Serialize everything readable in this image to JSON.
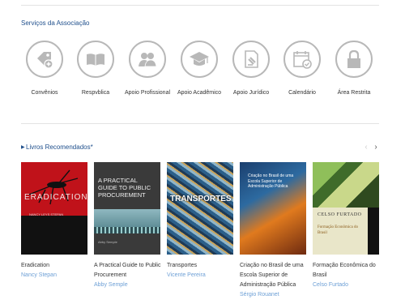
{
  "services_section": {
    "title": "Serviços da Associação",
    "items": [
      {
        "label": "Convênios",
        "icon": "tag-plus-icon"
      },
      {
        "label": "Respvblica",
        "icon": "open-book-icon"
      },
      {
        "label": "Apoio Profissional",
        "icon": "people-icon"
      },
      {
        "label": "Apoio Acadêmico",
        "icon": "graduation-cap-icon"
      },
      {
        "label": "Apoio Jurídico",
        "icon": "document-gavel-icon"
      },
      {
        "label": "Calendário",
        "icon": "calendar-check-icon"
      },
      {
        "label": "Área Restrita",
        "icon": "padlock-icon"
      }
    ]
  },
  "books_section": {
    "title": "Livros Recomendados*",
    "prev": "‹",
    "next": "›",
    "books": [
      {
        "title": "Eradication",
        "author": "Nancy Stepan",
        "cover_title": "ERADICATION",
        "cover_author": "NANCY LEYS STEPAN"
      },
      {
        "title": "A Practical Guide to Public Procurement",
        "author": "Abby Semple",
        "cover_title": "A PRACTICAL GUIDE TO PUBLIC PROCUREMENT",
        "cover_author": "Abby Semple"
      },
      {
        "title": "Transportes",
        "author": "Vicente Pereira",
        "cover_title": "TRANSPORTES"
      },
      {
        "title": "Criação no Brasil de uma Escola Superior de Administração Pública",
        "author": "Sérgio Rouanet",
        "cover_title": "Criação no Brasil de uma Escola Superior de Administração Pública"
      },
      {
        "title": "Formação Econômica do Brasil",
        "author": "Celso Furtado",
        "cover_author": "CELSO FURTADO",
        "cover_title": "Formação Econômica do Brasil"
      }
    ]
  },
  "colors": {
    "accent": "#1f4f8c",
    "link": "#6ea0d6",
    "icon_gray": "#b8b8b8"
  }
}
